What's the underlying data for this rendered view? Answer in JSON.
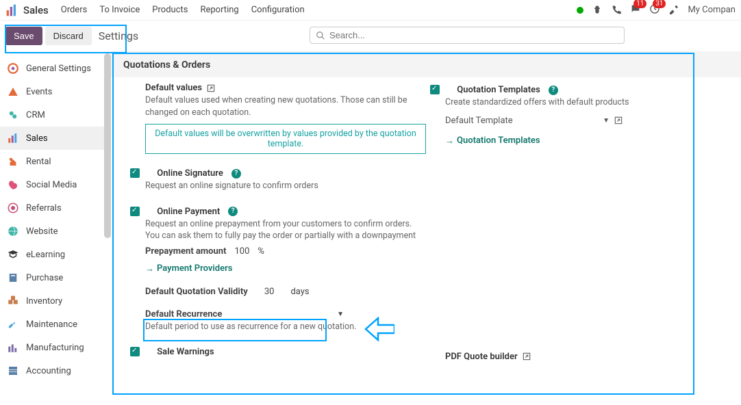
{
  "topnav": {
    "brand": "Sales",
    "menu": [
      "Orders",
      "To Invoice",
      "Products",
      "Reporting",
      "Configuration"
    ],
    "company": "My Compan",
    "badges": {
      "messages": "11",
      "activities": "31"
    }
  },
  "actionbar": {
    "save": "Save",
    "discard": "Discard",
    "breadcrumb": "Settings",
    "search_placeholder": "Search..."
  },
  "sidebar": {
    "items": [
      {
        "label": "General Settings"
      },
      {
        "label": "Events"
      },
      {
        "label": "CRM"
      },
      {
        "label": "Sales"
      },
      {
        "label": "Rental"
      },
      {
        "label": "Social Media"
      },
      {
        "label": "Referrals"
      },
      {
        "label": "Website"
      },
      {
        "label": "eLearning"
      },
      {
        "label": "Purchase"
      },
      {
        "label": "Inventory"
      },
      {
        "label": "Maintenance"
      },
      {
        "label": "Manufacturing"
      },
      {
        "label": "Accounting"
      }
    ]
  },
  "content": {
    "section_title": "Quotations & Orders",
    "left": {
      "default_values": {
        "title": "Default values",
        "desc": "Default values used when creating new quotations. Those can still be changed on each quotation.",
        "info": "Default values will be overwritten by values provided by the quotation template."
      },
      "online_signature": {
        "title": "Online Signature",
        "desc": "Request an online signature to confirm orders"
      },
      "online_payment": {
        "title": "Online Payment",
        "desc": "Request an online prepayment from your customers to confirm orders. You can ask them to fully pay the order or partially with a downpayment",
        "prepay_label": "Prepayment amount",
        "prepay_value": "100",
        "prepay_unit": "%",
        "providers_link": "Payment Providers"
      },
      "validity": {
        "label": "Default Quotation Validity",
        "value": "30",
        "unit": "days"
      },
      "recurrence": {
        "label": "Default Recurrence",
        "desc": "Default period to use as recurrence for a new quotation."
      },
      "sale_warnings": {
        "label": "Sale Warnings"
      }
    },
    "right": {
      "templates": {
        "title": "Quotation Templates",
        "desc": "Create standardized offers with default products",
        "default_template_label": "Default Template",
        "link": "Quotation Templates"
      },
      "pdf_quote": {
        "label": "PDF Quote builder"
      }
    }
  }
}
